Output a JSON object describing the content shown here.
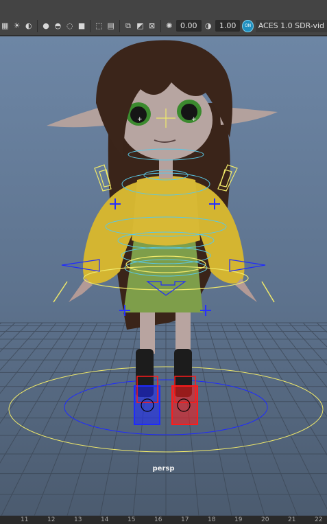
{
  "toolbar": {
    "icons": [
      "display-icon",
      "light-icon",
      "shading-icon",
      "smooth-shade-icon",
      "wireframe-icon",
      "xray-icon",
      "isolate-icon",
      "select-icon",
      "grid-icon",
      "camera-icon",
      "resolution-gate-icon",
      "gamma-icon",
      "exposure-icon"
    ],
    "exposure_value": "0.00",
    "gamma_value": "1.00",
    "view_transform_toggle": "ON",
    "color_space_label": "ACES 1.0 SDR-vid"
  },
  "viewport": {
    "camera_label": "persp"
  },
  "timeline": {
    "frame_numbers": [
      "11",
      "12",
      "13",
      "14",
      "15",
      "16",
      "17",
      "18",
      "19",
      "20",
      "21",
      "22"
    ]
  },
  "colors": {
    "viewport_top": "#6d86a5",
    "viewport_bottom": "#4b5b6f",
    "control_cyan": "#59c8e6",
    "control_yellow": "#f0e96a",
    "control_blue": "#1e2aff",
    "control_red": "#ff1b1b"
  }
}
